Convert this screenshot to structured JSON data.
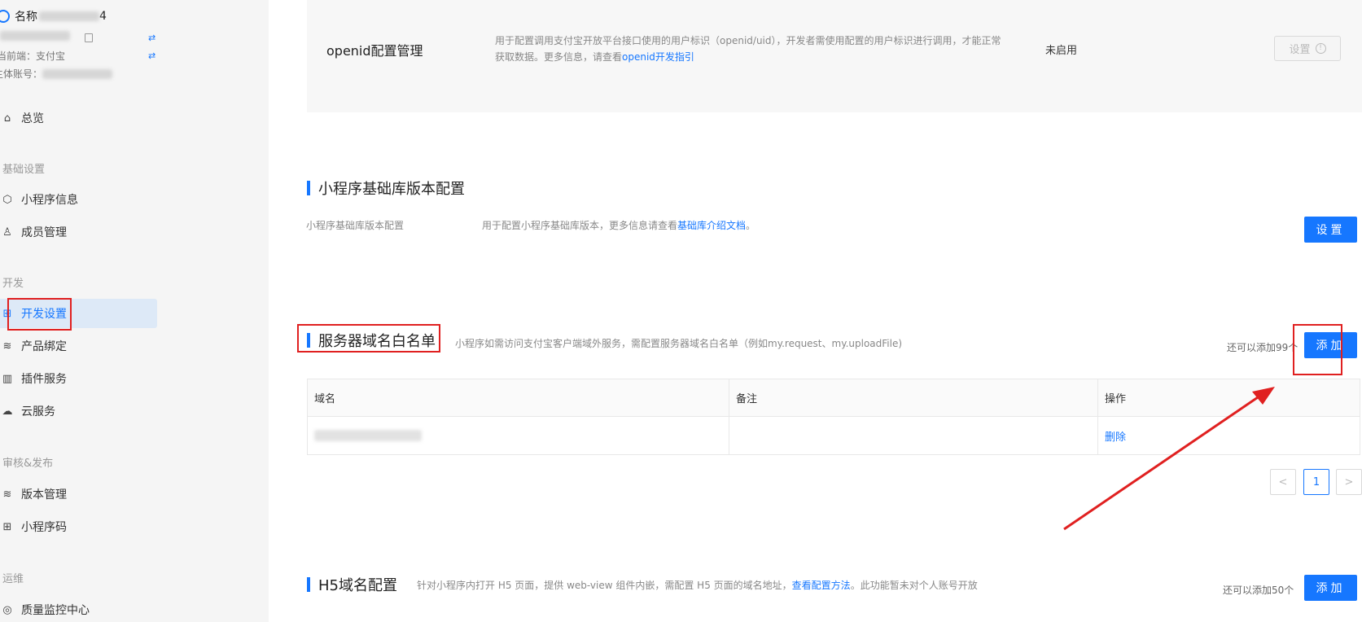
{
  "sidebar": {
    "account_name_label": "名称",
    "account_name_tail": "4",
    "platform_label": "前端：支付宝",
    "platform_prefix": "当前端：",
    "platform_value": "支付宝",
    "owner_label": "主体账号：",
    "swap_icon": "⇄",
    "overview": "总览",
    "group_basic": "基础设置",
    "mini_info": "小程序信息",
    "members": "成员管理",
    "group_dev": "开发",
    "dev_settings": "开发设置",
    "product_bind": "产品绑定",
    "plugin_service": "插件服务",
    "cloud_service": "云服务",
    "group_release": "审核&发布",
    "version_mgmt": "版本管理",
    "mini_code": "小程序码",
    "group_ops": "运维",
    "quality_center": "质量监控中心"
  },
  "openid": {
    "title": "openid配置管理",
    "desc_part1": "用于配置调用支付宝开放平台接口使用的用户标识（openid/uid），开发者需使用配置的用户标识进行调用，才能正常获取数据。更多信息，请查看",
    "desc_link": "openid开发指引",
    "status": "未启用",
    "set_button": "设置"
  },
  "base_lib": {
    "title": "小程序基础库版本配置",
    "row_label": "小程序基础库版本配置",
    "desc_part1": "用于配置小程序基础库版本，更多信息请查看",
    "desc_link": "基础库介绍文档",
    "desc_end": "。",
    "set_button": "设置"
  },
  "server_domain": {
    "title": "服务器域名白名单",
    "desc": "小程序如需访问支付宝客户端域外服务，需配置服务器域名白名单（例如my.request、my.uploadFile)",
    "remain": "还可以添加99个",
    "add_button": "添加",
    "columns": [
      "域名",
      "备注",
      "操作"
    ],
    "rows": [
      {
        "domain": "",
        "remark": "",
        "action": "删除"
      }
    ],
    "pagination": {
      "prev": "<",
      "current": "1",
      "next": ">"
    }
  },
  "h5_domain": {
    "title": "H5域名配置",
    "desc_part1": "针对小程序内打开 H5 页面，提供 web-view 组件内嵌，需配置 H5 页面的域名地址，",
    "desc_link": "查看配置方法",
    "desc_end": "。此功能暂未对个人账号开放",
    "remain": "还可以添加50个",
    "add_button": "添加"
  },
  "colors": {
    "accent": "#1677ff",
    "annotation": "#e02020",
    "sidebar_bg": "#f5f5f5",
    "active_bg": "#dde9f7"
  }
}
